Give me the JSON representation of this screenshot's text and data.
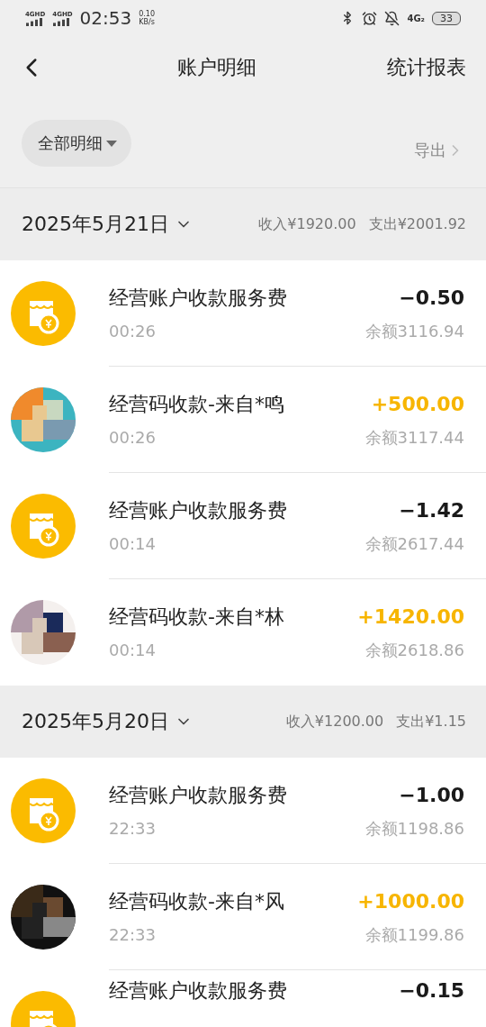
{
  "status_bar": {
    "sim_1": "4GHD",
    "sim_2": "4GHD",
    "time": "02:53",
    "speed_value": "0.10",
    "speed_unit": "KB/s",
    "network": "4G₂",
    "battery": "33"
  },
  "header": {
    "title": "账户明细",
    "action": "统计报表"
  },
  "filter": {
    "label": "全部明细",
    "export": "导出"
  },
  "sections": [
    {
      "date": "2025年5月21日",
      "income": "收入¥1920.00",
      "expense": "支出¥2001.92",
      "rows": [
        {
          "kind": "fee",
          "title": "经营账户收款服务费",
          "time": "00:26",
          "amount": "−0.50",
          "positive": false,
          "balance": "余额3116.94"
        },
        {
          "title": "经营码收款-来自*鸣",
          "time": "00:26",
          "amount": "+500.00",
          "positive": true,
          "balance": "余额3117.44"
        },
        {
          "kind": "fee",
          "title": "经营账户收款服务费",
          "time": "00:14",
          "amount": "−1.42",
          "positive": false,
          "balance": "余额2617.44"
        },
        {
          "title": "经营码收款-来自*林",
          "time": "00:14",
          "amount": "+1420.00",
          "positive": true,
          "balance": "余额2618.86"
        }
      ]
    },
    {
      "date": "2025年5月20日",
      "income": "收入¥1200.00",
      "expense": "支出¥1.15",
      "rows": [
        {
          "kind": "fee",
          "title": "经营账户收款服务费",
          "time": "22:33",
          "amount": "−1.00",
          "positive": false,
          "balance": "余额1198.86"
        },
        {
          "title": "经营码收款-来自*风",
          "time": "22:33",
          "amount": "+1000.00",
          "positive": true,
          "balance": "余额1199.86"
        },
        {
          "kind": "fee",
          "title": "经营账户收款服务费",
          "amount": "−0.15",
          "positive": false
        }
      ]
    }
  ]
}
